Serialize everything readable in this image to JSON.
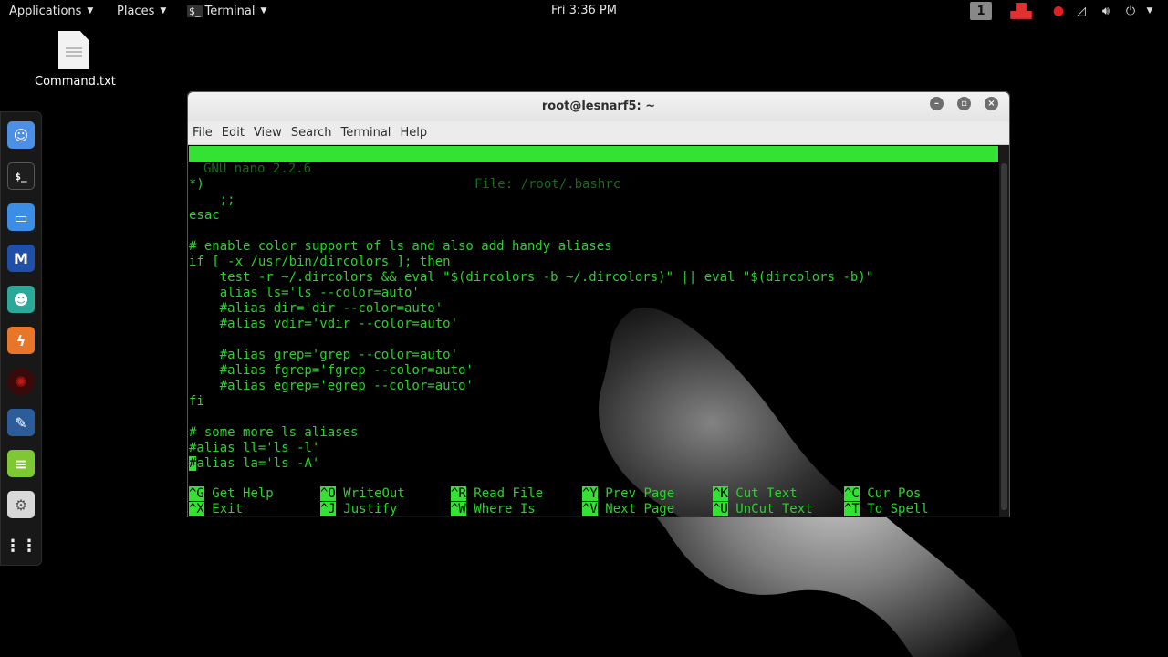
{
  "panel": {
    "applications": "Applications",
    "places": "Places",
    "terminal": "Terminal",
    "clock": "Fri  3:36 PM",
    "workspace": "1"
  },
  "desktop": {
    "file_label": "Command.txt"
  },
  "dock": {
    "items": [
      "chat-app",
      "terminal",
      "files",
      "metasploit",
      "anime-avatar",
      "burp",
      "armitage",
      "tools",
      "notes",
      "settings",
      "app-grid"
    ]
  },
  "window": {
    "title": "root@lesnarf5: ~",
    "menu": [
      "File",
      "Edit",
      "View",
      "Search",
      "Terminal",
      "Help"
    ]
  },
  "nano": {
    "version": "GNU nano 2.2.6",
    "file": "File: /root/.bashrc",
    "lines": [
      "*)",
      "    ;;",
      "esac",
      "",
      "# enable color support of ls and also add handy aliases",
      "if [ -x /usr/bin/dircolors ]; then",
      "    test -r ~/.dircolors && eval \"$(dircolors -b ~/.dircolors)\" || eval \"$(dircolors -b)\"",
      "    alias ls='ls --color=auto'",
      "    #alias dir='dir --color=auto'",
      "    #alias vdir='vdir --color=auto'",
      "",
      "    #alias grep='grep --color=auto'",
      "    #alias fgrep='fgrep --color=auto'",
      "    #alias egrep='egrep --color=auto'",
      "fi",
      "",
      "# some more ls aliases",
      "#alias ll='ls -l'"
    ],
    "cursor_line_first": "#",
    "cursor_line_rest": "alias la='ls -A'",
    "shortcuts_row1": [
      {
        "key": "^G",
        "label": "Get Help"
      },
      {
        "key": "^O",
        "label": "WriteOut"
      },
      {
        "key": "^R",
        "label": "Read File"
      },
      {
        "key": "^Y",
        "label": "Prev Page"
      },
      {
        "key": "^K",
        "label": "Cut Text"
      },
      {
        "key": "^C",
        "label": "Cur Pos"
      }
    ],
    "shortcuts_row2": [
      {
        "key": "^X",
        "label": "Exit"
      },
      {
        "key": "^J",
        "label": "Justify"
      },
      {
        "key": "^W",
        "label": "Where Is"
      },
      {
        "key": "^V",
        "label": "Next Page"
      },
      {
        "key": "^U",
        "label": "UnCut Text"
      },
      {
        "key": "^T",
        "label": "To Spell"
      }
    ]
  },
  "colors": {
    "terminal_green": "#2bd22b",
    "nano_bar": "#34e234",
    "titlebar": "#ececec"
  }
}
